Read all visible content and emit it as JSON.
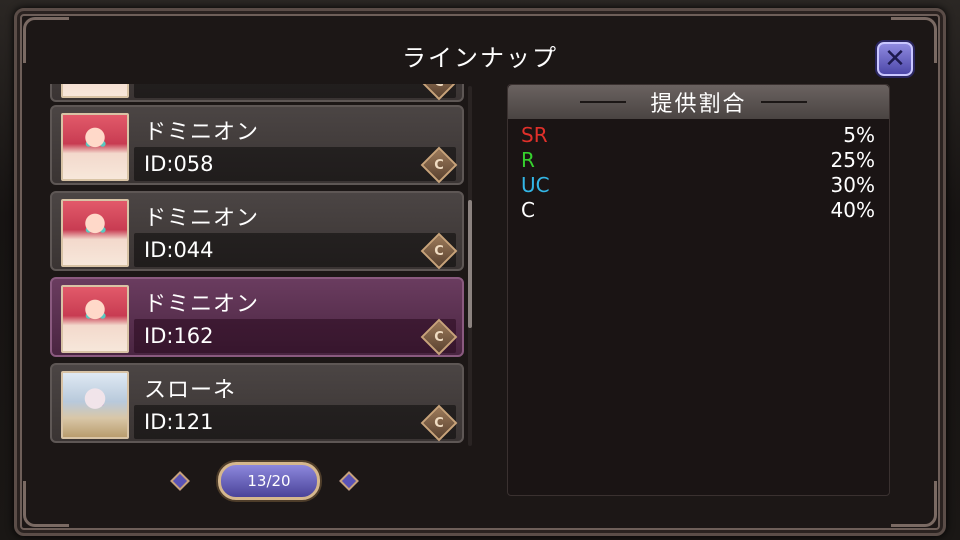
{
  "title": "ラインナップ",
  "close_icon": "close-icon",
  "list": [
    {
      "name": "ドミニオン",
      "id": "ID:058",
      "rarity": "C",
      "portrait": "red-haired-girl"
    },
    {
      "name": "ドミニオン",
      "id": "ID:044",
      "rarity": "C",
      "portrait": "red-haired-girl"
    },
    {
      "name": "ドミニオン",
      "id": "ID:162",
      "rarity": "C",
      "portrait": "red-haired-girl",
      "selected": true
    },
    {
      "name": "スローネ",
      "id": "ID:121",
      "rarity": "C",
      "portrait": "white-haired-girl"
    }
  ],
  "pager": {
    "label": "13/20"
  },
  "rates": {
    "header": "提供割合",
    "rows": [
      {
        "label": "SR",
        "value": "5%",
        "color": "#e0302a"
      },
      {
        "label": "R",
        "value": "25%",
        "color": "#36d02e"
      },
      {
        "label": "UC",
        "value": "30%",
        "color": "#33b6e6"
      },
      {
        "label": "C",
        "value": "40%",
        "color": "#ffffff"
      }
    ]
  }
}
